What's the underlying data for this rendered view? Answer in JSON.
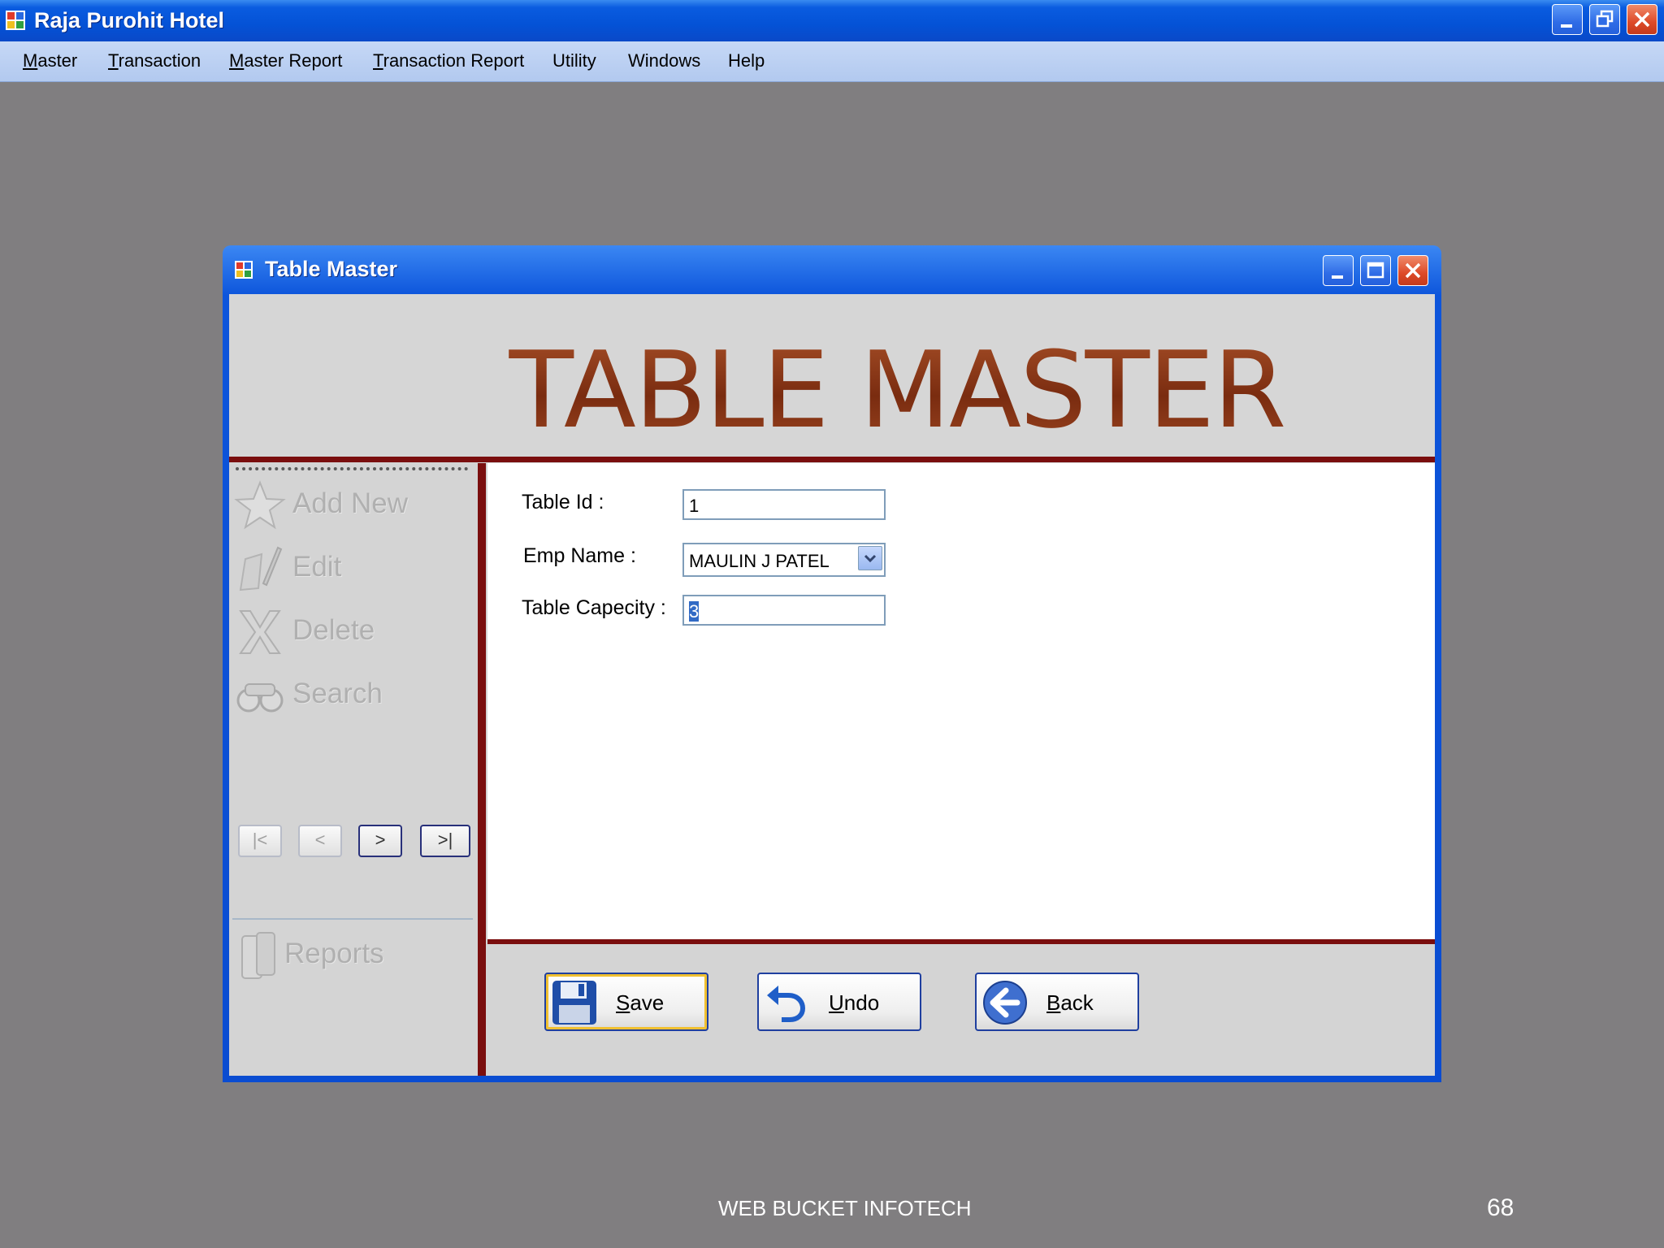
{
  "app": {
    "title": "Raja Purohit Hotel"
  },
  "menu": [
    {
      "pre": "",
      "u": "M",
      "post": "aster"
    },
    {
      "pre": "",
      "u": "T",
      "post": "ransaction"
    },
    {
      "pre": "",
      "u": "M",
      "post": "aster Report"
    },
    {
      "pre": "",
      "u": "T",
      "post": "ransaction Report"
    },
    {
      "pre": "",
      "u": "",
      "post": "Utility"
    },
    {
      "pre": "",
      "u": "",
      "post": "Windows"
    },
    {
      "pre": "",
      "u": "",
      "post": "Help"
    }
  ],
  "dialog": {
    "title": "Table Master",
    "banner": "TABLE MASTER"
  },
  "sidebar": {
    "add_new": "Add New",
    "edit": "Edit",
    "delete": "Delete",
    "search": "Search",
    "reports": "Reports"
  },
  "nav": {
    "first": "|<",
    "prev": "<",
    "next": ">",
    "last": ">|"
  },
  "form": {
    "table_id_label": "Table Id :",
    "table_id_value": "1",
    "emp_name_label": "Emp Name :",
    "emp_name_value": "MAULIN J PATEL",
    "capacity_label": "Table Capecity :",
    "capacity_value": "3"
  },
  "actions": {
    "save_u": "S",
    "save_rest": "ave",
    "undo_u": "U",
    "undo_rest": "ndo",
    "back_u": "B",
    "back_rest": "ack"
  },
  "footer": {
    "company": "WEB BUCKET INFOTECH",
    "page": "68"
  },
  "colors": {
    "titlebar": "#0452d6",
    "banner_text": "#8a3a1a",
    "divider": "#7a0e0e",
    "background": "#807e80"
  }
}
